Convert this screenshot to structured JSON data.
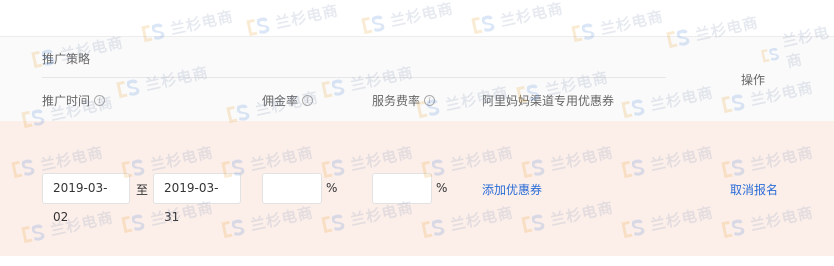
{
  "section": {
    "group_title": "推广策略",
    "columns": {
      "time": "推广时间",
      "commission": "佣金率",
      "service": "服务费率",
      "coupon": "阿里妈妈渠道专用优惠券"
    },
    "operations_header": "操作"
  },
  "row": {
    "start_date": "2019-03-02",
    "to_label": "至",
    "end_date": "2019-03-31",
    "commission_value": "",
    "commission_unit": "%",
    "service_value": "",
    "service_unit": "%",
    "add_coupon": "添加优惠券",
    "cancel": "取消报名"
  },
  "watermark": {
    "text": "兰杉电商",
    "logo_icon": "s-logo-icon"
  },
  "colors": {
    "row_background": "#fcefea",
    "header_background": "#fafafa",
    "link": "#2a6cd6"
  }
}
